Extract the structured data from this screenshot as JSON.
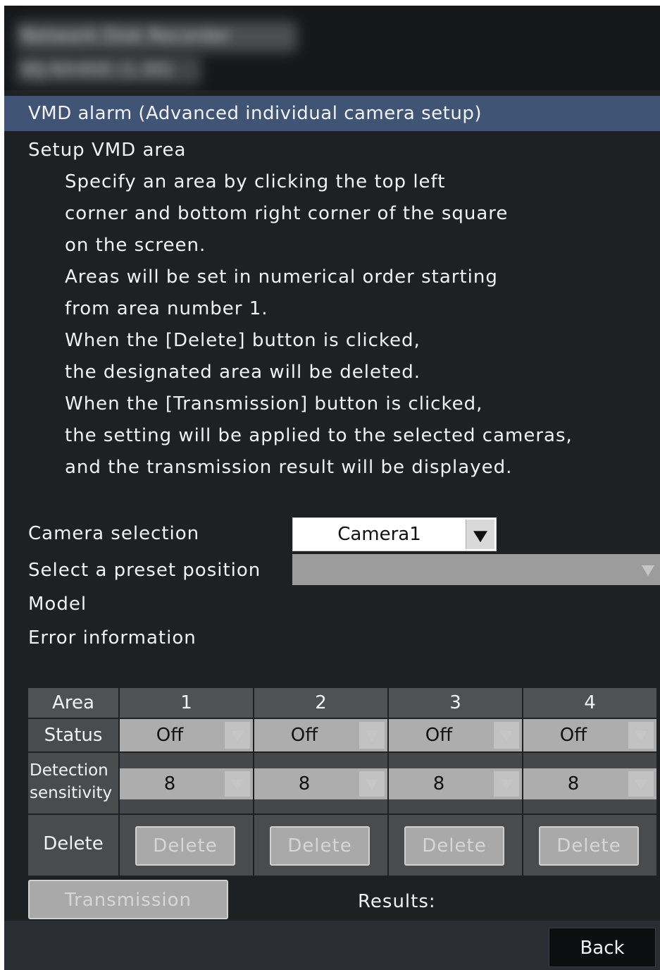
{
  "header": {
    "line1": "Network Disk Recorder",
    "line2": "WJ-NX400 (1.00)"
  },
  "title": "VMD alarm (Advanced individual camera setup)",
  "instructions": {
    "heading": "Setup VMD area",
    "lines": [
      "Specify an area by clicking the top left",
      "corner and bottom right corner of the square",
      "on the screen.",
      "Areas will be set in numerical order starting",
      "from area number 1.",
      "When the [Delete] button is clicked,",
      "the designated area will be deleted.",
      "When the [Transmission]  button is clicked,",
      "the setting will be applied to the selected cameras,",
      "and the transmission result will be displayed."
    ]
  },
  "form": {
    "camera_selection_label": "Camera selection",
    "camera_selection_value": "Camera1",
    "preset_label": "Select a preset position",
    "preset_value": "",
    "model_label": "Model",
    "error_label": "Error information"
  },
  "table": {
    "area_label": "Area",
    "status_label": "Status",
    "detection_label_1": "Detection",
    "detection_label_2": "sensitivity",
    "delete_label": "Delete",
    "areas": [
      {
        "number": "1",
        "status": "Off",
        "sensitivity": "8",
        "delete_button": "Delete"
      },
      {
        "number": "2",
        "status": "Off",
        "sensitivity": "8",
        "delete_button": "Delete"
      },
      {
        "number": "3",
        "status": "Off",
        "sensitivity": "8",
        "delete_button": "Delete"
      },
      {
        "number": "4",
        "status": "Off",
        "sensitivity": "8",
        "delete_button": "Delete"
      }
    ]
  },
  "footer": {
    "transmission_button": "Transmission",
    "results_label": "Results:",
    "back_button": "Back"
  },
  "colors": {
    "title_bar": "#405475",
    "background": "#1e2022",
    "cell": "#494b4d",
    "dropdown": "#adadad"
  }
}
